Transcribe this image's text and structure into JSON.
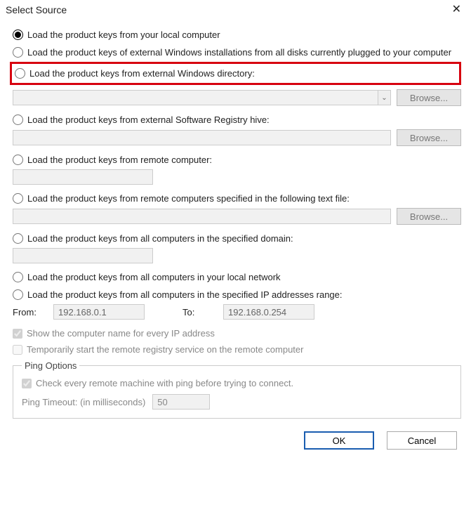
{
  "titlebar": {
    "title": "Select Source"
  },
  "options": {
    "local": {
      "label": "Load the product keys from your local computer"
    },
    "all_disks": {
      "label": "Load the product keys of external Windows installations from all disks currently plugged to your computer"
    },
    "ext_dir": {
      "label": "Load the product keys from external Windows directory:",
      "browse": "Browse...",
      "value": ""
    },
    "reg_hive": {
      "label": "Load the product keys from external Software Registry hive:",
      "browse": "Browse...",
      "value": ""
    },
    "remote_one": {
      "label": "Load the product keys from remote computer:",
      "value": ""
    },
    "remote_file": {
      "label": "Load the product keys from remote computers specified in the following text file:",
      "browse": "Browse...",
      "value": ""
    },
    "domain": {
      "label": "Load the product keys from all computers in the specified domain:",
      "value": ""
    },
    "local_net": {
      "label": "Load the product keys from all computers in your local network"
    },
    "ip_range": {
      "label": "Load the product keys from all computers in the specified IP addresses range:",
      "from_label": "From:",
      "from_value": "192.168.0.1",
      "to_label": "To:",
      "to_value": "192.168.0.254"
    }
  },
  "checks": {
    "show_name": {
      "label": "Show the computer name for every IP address"
    },
    "temp_remote": {
      "label": "Temporarily start the remote registry service on the remote computer"
    }
  },
  "ping": {
    "legend": "Ping Options",
    "check_label": "Check every remote machine with ping before trying to connect.",
    "timeout_label": "Ping Timeout: (in milliseconds)",
    "timeout_value": "50"
  },
  "footer": {
    "ok": "OK",
    "cancel": "Cancel"
  }
}
